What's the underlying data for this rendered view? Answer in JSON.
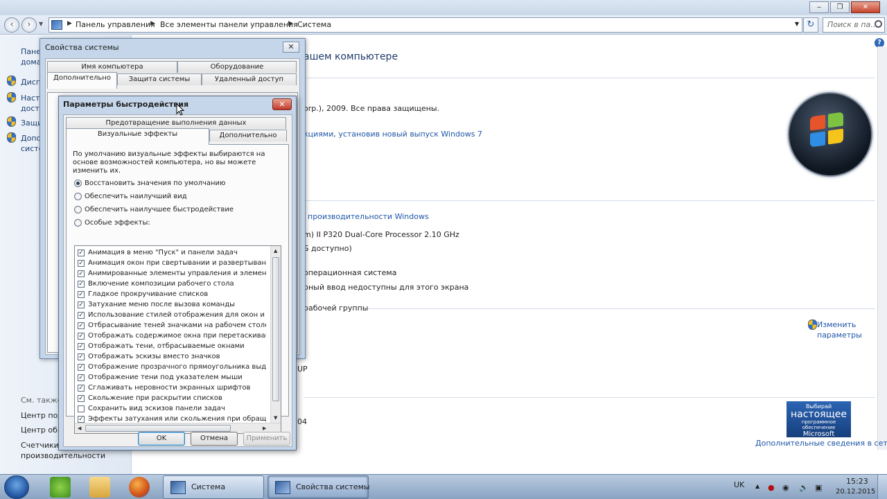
{
  "explorer": {
    "breadcrumb": [
      "Панель управления",
      "Все элементы панели управления",
      "Система"
    ],
    "search_placeholder": "Поиск в па...",
    "left_pane": {
      "items": [
        "Дисп",
        "Настр\nдосту",
        "Защи",
        "Допо\nсисте"
      ],
      "top_item": "Пане\nдома",
      "see_also": "См. также",
      "links": [
        "Центр под",
        "Центр обн",
        "Счетчики",
        "производительности"
      ]
    },
    "main": {
      "heading_fragment": "ашем компьютере",
      "copyright_fragment": "orp.), 2009. Все права защищены.",
      "features_link_fragment": "кциями, установив новый выпуск Windows 7",
      "perf_link_fragment": "производительности Windows",
      "processor_fragment": "m) II P320 Dual-Core Processor   2.10 GHz",
      "ram_fragment": "Б доступно)",
      "os_type_fragment": "операционная система",
      "pen_fragment": "рный ввод недоступны для этого экрана",
      "workgroup_fragment": "рабочей группы",
      "change_settings_link": "Изменить\nпараметры",
      "workgroup_name_fragment": "UP",
      "product_id_fragment": "04",
      "more_info_link": "Дополнительные сведения в сети...",
      "genuine_badge": {
        "line1": "Выбирай",
        "line2": "настоящее",
        "line3": "программное обеспечение",
        "line4": "Microsoft"
      }
    }
  },
  "system_properties": {
    "title": "Свойства системы",
    "close_glyph": "✕",
    "tabs_back": [
      "Имя компьютера",
      "Оборудование"
    ],
    "tabs_front": [
      "Дополнительно",
      "Защита системы",
      "Удаленный доступ"
    ]
  },
  "performance": {
    "title": "Параметры быстродействия",
    "close_glyph": "✕",
    "tab_back": "Предотвращение выполнения данных",
    "tabs_front": [
      "Визуальные эффекты",
      "Дополнительно"
    ],
    "description": "По умолчанию визуальные эффекты выбираются на основе возможностей компьютера, но вы можете изменить их.",
    "radios": [
      {
        "label": "Восстановить значения по умолчанию",
        "selected": true
      },
      {
        "label": "Обеспечить наилучший вид",
        "selected": false
      },
      {
        "label": "Обеспечить наилучшее быстродействие",
        "selected": false
      },
      {
        "label": "Особые эффекты:",
        "selected": false
      }
    ],
    "effects": [
      {
        "label": "Анимация в меню \"Пуск\" и панели задач",
        "checked": true
      },
      {
        "label": "Анимация окон при свертывании и развертывании",
        "checked": true
      },
      {
        "label": "Анимированные элементы управления и элементы вну",
        "checked": true
      },
      {
        "label": "Включение композиции рабочего стола",
        "checked": true
      },
      {
        "label": "Гладкое прокручивание списков",
        "checked": true
      },
      {
        "label": "Затухание меню после вызова команды",
        "checked": true
      },
      {
        "label": "Использование стилей отображения для окон и кнопок",
        "checked": true
      },
      {
        "label": "Отбрасывание теней значками на рабочем столе",
        "checked": true
      },
      {
        "label": "Отображать содержимое окна при перетаскивании",
        "checked": true
      },
      {
        "label": "Отображать тени, отбрасываемые окнами",
        "checked": true
      },
      {
        "label": "Отображать эскизы вместо значков",
        "checked": true
      },
      {
        "label": "Отображение прозрачного прямоугольника выделения",
        "checked": true
      },
      {
        "label": "Отображение тени под указателем мыши",
        "checked": true
      },
      {
        "label": "Сглаживать неровности экранных шрифтов",
        "checked": true
      },
      {
        "label": "Скольжение при раскрытии списков",
        "checked": true
      },
      {
        "label": "Сохранить вид эскизов панели задач",
        "checked": false
      },
      {
        "label": "Эффекты затухания или скольжения при обращении к",
        "checked": true
      }
    ],
    "buttons": {
      "ok": "OK",
      "cancel": "Отмена",
      "apply": "Применить"
    }
  },
  "taskbar": {
    "tasks": [
      {
        "label": "Система",
        "active": false
      },
      {
        "label": "Свойства системы",
        "active": true
      }
    ],
    "language": "UK",
    "clock_time": "15:23",
    "clock_date": "20.12.2015"
  },
  "colors": {
    "link": "#1f56a8",
    "close_red": "#c0392b",
    "taskbar": "#8aa3c2"
  }
}
